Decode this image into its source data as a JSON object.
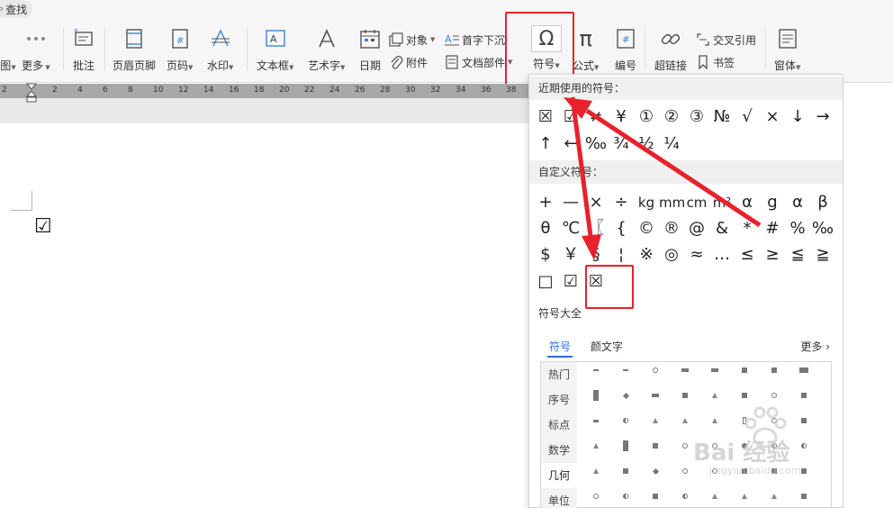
{
  "search": {
    "label": "查找"
  },
  "ribbon": {
    "partial_left": "图",
    "more": "更多",
    "comment": "批注",
    "header_footer": "页眉页脚",
    "page_number": "页码",
    "watermark": "水印",
    "textbox": "文本框",
    "wordart": "艺术字",
    "date": "日期",
    "object": "对象",
    "attachment": "附件",
    "dropcap": "首字下沉",
    "doc_parts": "文档部件",
    "symbol": "符号",
    "formula": "公式",
    "numbering": "编号",
    "hyperlink": "超链接",
    "cross_ref": "交叉引用",
    "bookmark": "书签",
    "window": "窗体"
  },
  "ruler": {
    "numbers": [
      "2",
      "2",
      "2",
      "4",
      "6",
      "8",
      "10",
      "12",
      "14",
      "16",
      "18",
      "20",
      "22",
      "24",
      "26",
      "28",
      "30",
      "32",
      "34",
      "36",
      "38"
    ]
  },
  "document": {
    "inserted_char": "☑"
  },
  "panel": {
    "recent_title": "近期使用的符号：",
    "recent_row1": [
      "☒",
      "☑",
      "≠",
      "¥",
      "①",
      "②",
      "③",
      "№",
      "√",
      "×",
      "↓",
      "→"
    ],
    "recent_row2": [
      "↑",
      "←",
      "‰",
      "¾",
      "½",
      "¼"
    ],
    "custom_title": "自定义符号：",
    "custom_row1": [
      "+",
      "—",
      "×",
      "÷",
      "kg",
      "mm",
      "cm",
      "m²",
      "α",
      "g",
      "α",
      "β"
    ],
    "custom_row2": [
      "θ",
      "℃",
      "〖",
      "{",
      "©",
      "®",
      "@",
      "&",
      "*",
      "#",
      "%",
      "‰"
    ],
    "custom_row3": [
      "$",
      "￥",
      "§",
      "¦",
      "※",
      "◎",
      "≈",
      "…",
      "≤",
      "≥",
      "≦",
      "≧"
    ],
    "custom_row4": [
      "□",
      "☑",
      "☒"
    ],
    "all_title": "符号大全",
    "tabs": [
      "符号",
      "颜文字"
    ],
    "more": "更多",
    "categories": [
      "热门",
      "序号",
      "标点",
      "数学",
      "几何",
      "单位"
    ]
  },
  "watermark": {
    "brand": "Bai 经验",
    "url": "jingyan.baidu.com"
  },
  "colors": {
    "annotation_red": "#e8212c",
    "tab_blue": "#2d6ee0",
    "ruler_gray": "#a8a8a8"
  }
}
